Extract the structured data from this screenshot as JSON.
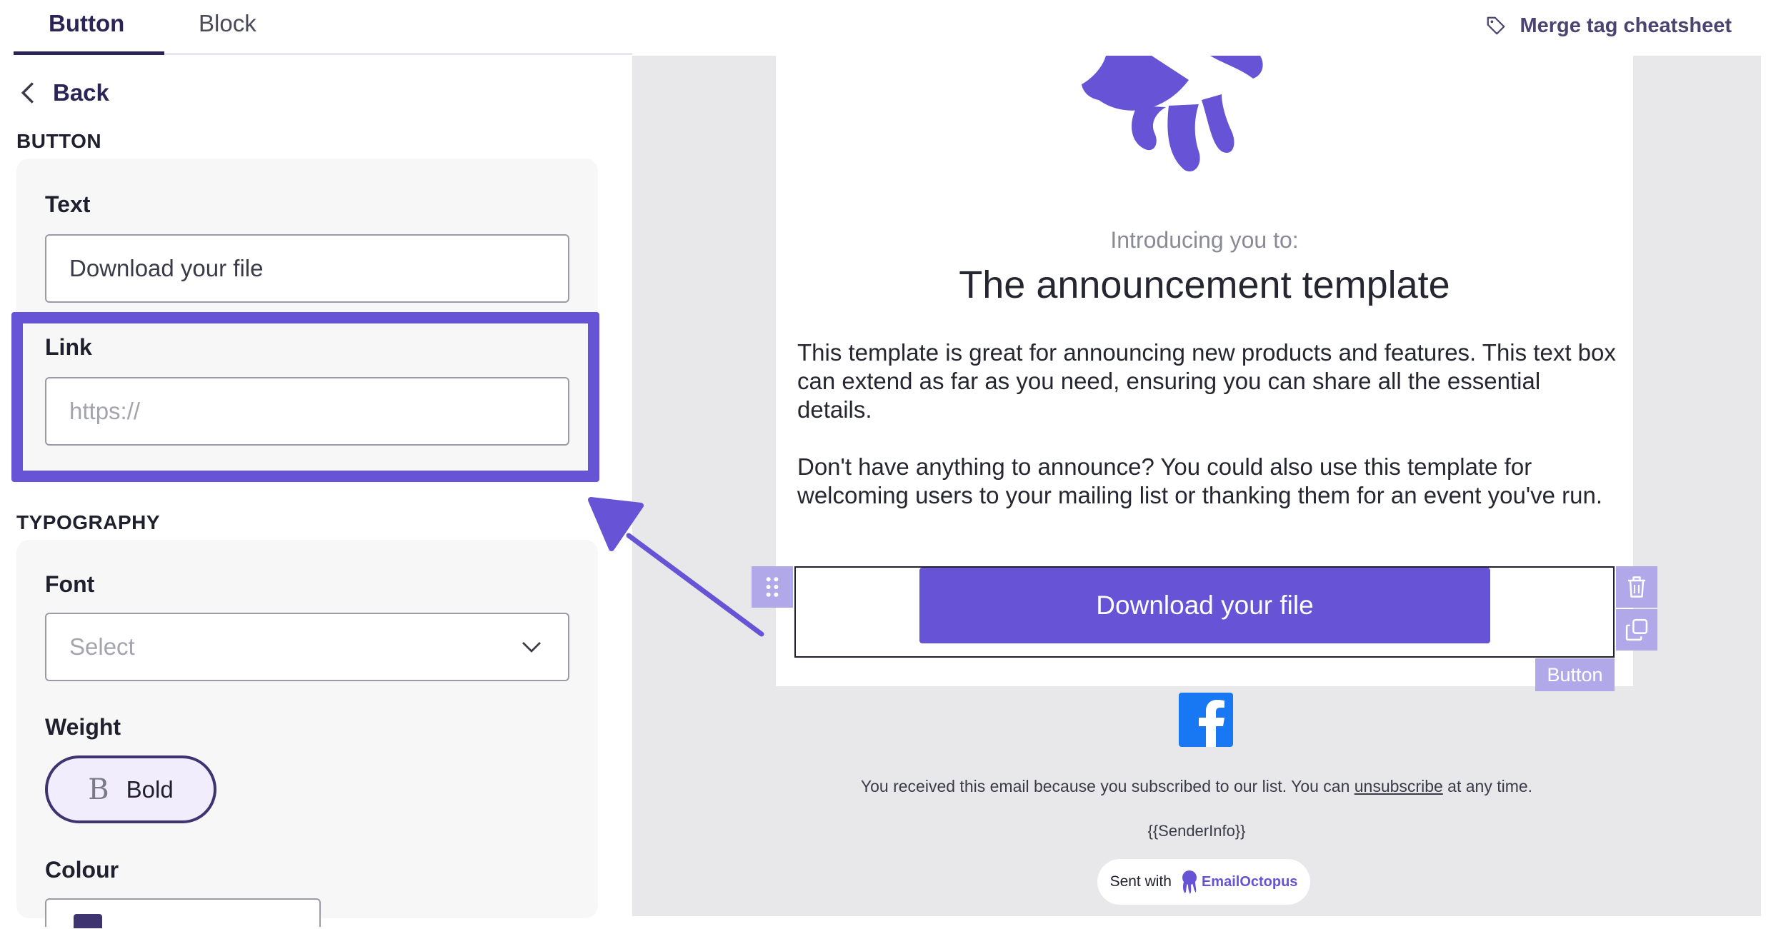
{
  "tabs": [
    {
      "label": "Button",
      "active": true
    },
    {
      "label": "Block",
      "active": false
    }
  ],
  "cheatsheet": {
    "label": "Merge tag cheatsheet",
    "icon": "tag-icon"
  },
  "back": {
    "label": "Back",
    "icon": "chevron-left-icon"
  },
  "button_section": {
    "heading": "BUTTON",
    "text_label": "Text",
    "text_value": "Download your file",
    "link_label": "Link",
    "link_placeholder": "https://"
  },
  "typography": {
    "heading": "TYPOGRAPHY",
    "font_label": "Font",
    "font_placeholder": "Select",
    "weight_label": "Weight",
    "weight_value": "Bold",
    "colour_label": "Colour"
  },
  "preview": {
    "intro": "Introducing you to:",
    "title": "The announcement template",
    "paragraph1": "This template is great for announcing new products and features. This text box can extend as far as you need, ensuring you can share all the essential details.",
    "paragraph2": "Don't have anything to announce? You could also use this template for welcoming users to your mailing list or thanking them for an event you've run.",
    "button_text": "Download your file",
    "block_tag": "Button",
    "footer_prefix": "You received this email because you subscribed to our list. You can ",
    "footer_link": "unsubscribe",
    "footer_suffix": " at any time.",
    "sender_info": "{{SenderInfo}}",
    "badge_prefix": "Sent with",
    "badge_brand": "EmailOctopus"
  },
  "colors": {
    "accent": "#6653d6",
    "dark": "#2a2556",
    "preview_bg": "#e8e8eb",
    "tool_bg": "#b1a8ea"
  }
}
